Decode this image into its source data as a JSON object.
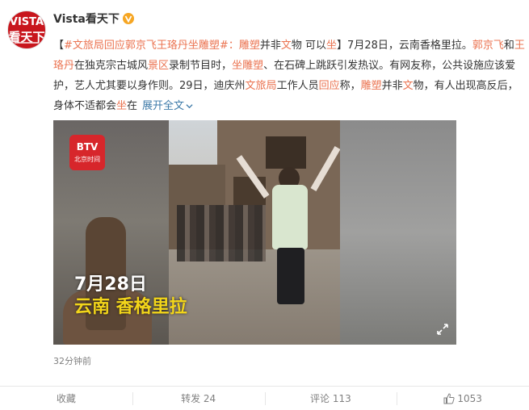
{
  "post": {
    "avatar": {
      "line1": "VISTA",
      "line2": "看天下"
    },
    "username": "Vista看天下",
    "verified_icon": "verified-v-icon",
    "text": {
      "open_bracket": "【",
      "hashtag": "#文旅局回应郭京飞王珞丹坐雕塑#",
      "colon": "：",
      "headline_p1": "雕塑",
      "headline_p2": "并非",
      "headline_p3": "文",
      "headline_p4": "物 可以",
      "headline_p5": "坐",
      "close_bracket": "】",
      "body_p1": "7月28日，云南香格里拉。",
      "name1": "郭京飞",
      "body_p2": "和",
      "name2": "王珞丹",
      "body_p3": "在独克宗古城风",
      "kw_scenic": "景区",
      "body_p4": "录制节目时，",
      "kw_sit": "坐雕塑",
      "body_p5": "、在石碑上跳跃引发热议。有网友称，公共设施应该爱护，艺人尤其要以身作则。29日，迪庆州",
      "kw_bureau": "文旅局",
      "body_p6": "工作人员",
      "kw_reply": "回应",
      "body_p7": "称，",
      "kw_statue": "雕塑",
      "body_p8": "并非",
      "kw_wen": "文",
      "body_p9": "物，有人出现高反后，身体不适都会",
      "kw_sit2": "坐",
      "body_p10": "在",
      "expand": "展开全文",
      "expand_icon": "chevron-down-icon"
    },
    "video": {
      "channel_logo_line1": "BTV",
      "channel_logo_line2": "北京时间",
      "overlay_date": "7月28日",
      "overlay_location": "云南 香格里拉",
      "fullscreen_icon": "expand-arrows-icon"
    },
    "timestamp": "32分钟前"
  },
  "actions": {
    "favorite": "收藏",
    "repost": "转发 24",
    "comment": "评论 113",
    "like": "1053",
    "like_icon": "thumbs-up-icon"
  },
  "colors": {
    "keyword": "#eb7350",
    "link": "#3d7aa8",
    "brand_red": "#c8161d",
    "overlay_yellow": "#f2d51a"
  }
}
